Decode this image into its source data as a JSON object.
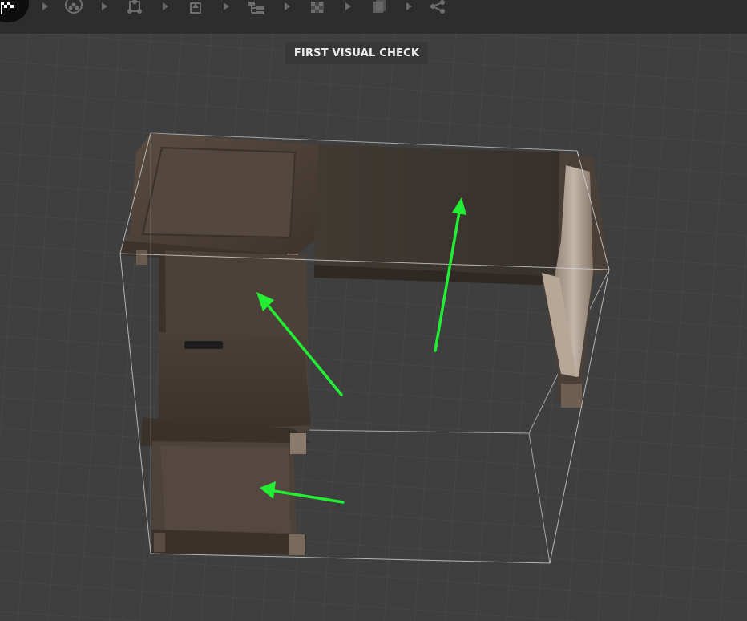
{
  "window": {
    "step_title": "FIRST VISUAL CHECK"
  },
  "toolbar": {
    "items": [
      {
        "name": "flag-icon"
      },
      {
        "name": "nodes-icon"
      },
      {
        "name": "skeleton-icon"
      },
      {
        "name": "box-down-icon"
      },
      {
        "name": "hierarchy-icon"
      },
      {
        "name": "checker-icon"
      },
      {
        "name": "material-icon"
      },
      {
        "name": "share-icon"
      }
    ]
  },
  "colors": {
    "background": "#3f3f3f",
    "grid": "#4d4d4d",
    "toolbar": "#2d2d2d",
    "annotation_arrow": "#22ee33",
    "wood": "#4a3f36",
    "label_bg": "#383838"
  }
}
